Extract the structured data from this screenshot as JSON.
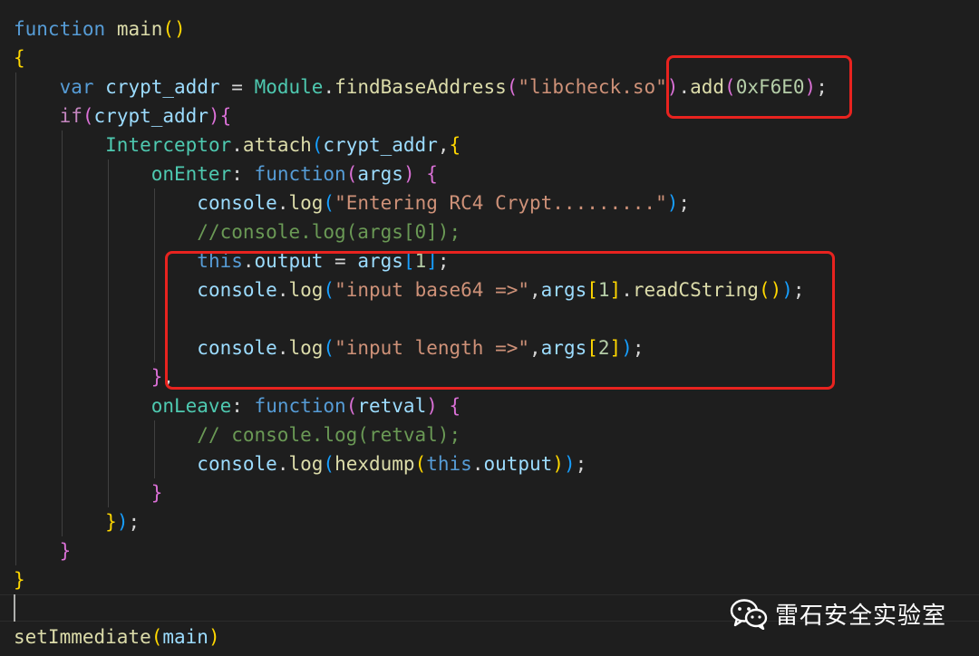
{
  "editor": {
    "language": "javascript",
    "theme": "dark",
    "lines": {
      "l1": {
        "kw": "function",
        "name": "main",
        "parens": "()"
      },
      "l2": {
        "brace": "{"
      },
      "l3": {
        "kw": "var",
        "ident": "crypt_addr",
        "op": "=",
        "cls": "Module",
        "dot1": ".",
        "fn1": "findBaseAddress",
        "p1": "(",
        "str": "\"libcheck.so\"",
        "p2": ")",
        "dot2": ".",
        "fn2": "add",
        "p3": "(",
        "num": "0xF6E0",
        "p4": ")",
        "semi": ";"
      },
      "l4": {
        "ctl": "if",
        "p1": "(",
        "var": "crypt_addr",
        "p2": ")",
        "brace": "{"
      },
      "l5": {
        "cls": "Interceptor",
        "dot": ".",
        "fn": "attach",
        "p1": "(",
        "var": "crypt_addr",
        "comma": ",",
        "brace": "{"
      },
      "l6": {
        "prop": "onEnter",
        "colon": ":",
        "kw": "function",
        "p1": "(",
        "var": "args",
        "p2": ")",
        "brace": "{"
      },
      "l7": {
        "obj": "console",
        "dot": ".",
        "fn": "log",
        "p1": "(",
        "str": "\"Entering RC4 Crypt.........\"",
        "p2": ")",
        "semi": ";"
      },
      "l8": {
        "comment": "//console.log(args[0]);"
      },
      "l9": {
        "kw": "this",
        "dot": ".",
        "prop": "output",
        "op": "=",
        "var": "args",
        "b1": "[",
        "num": "1",
        "b2": "]",
        "semi": ";"
      },
      "l10": {
        "obj": "console",
        "dot": ".",
        "fn": "log",
        "p1": "(",
        "str": "\"input base64 =>\"",
        "comma": ",",
        "var": "args",
        "b1": "[",
        "num": "1",
        "b2": "]",
        "dot2": ".",
        "fn2": "readCString",
        "p2": "()",
        "p3": ")",
        "semi": ";"
      },
      "l11": {},
      "l12": {
        "obj": "console",
        "dot": ".",
        "fn": "log",
        "p1": "(",
        "str": "\"input length =>\"",
        "comma": ",",
        "var": "args",
        "b1": "[",
        "num": "2",
        "b2": "]",
        "p2": ")",
        "semi": ";"
      },
      "l13": {
        "brace": "}",
        "comma": ","
      },
      "l14": {
        "prop": "onLeave",
        "colon": ":",
        "kw": "function",
        "p1": "(",
        "var": "retval",
        "p2": ")",
        "brace": "{"
      },
      "l15": {
        "comment": "// console.log(retval);"
      },
      "l16": {
        "obj": "console",
        "dot": ".",
        "fn": "log",
        "p1": "(",
        "fn2": "hexdump",
        "p2": "(",
        "kw": "this",
        "dot2": ".",
        "prop": "output",
        "p3": ")",
        "p4": ")",
        "semi": ";"
      },
      "l17": {
        "brace": "}"
      },
      "l18": {
        "brace": "}",
        "paren": ")",
        "semi": ";"
      },
      "l19": {
        "brace": "}"
      },
      "l20": {
        "brace": "}"
      },
      "l22": {
        "fn": "setImmediate",
        "p1": "(",
        "var": "main",
        "p2": ")"
      }
    }
  },
  "annotations": {
    "box_color": "#e8231f",
    "boxes": [
      "offset-highlight",
      "args-logging-highlight"
    ]
  },
  "watermark": {
    "icon": "wechat-icon",
    "text": "雷石安全实验室"
  }
}
